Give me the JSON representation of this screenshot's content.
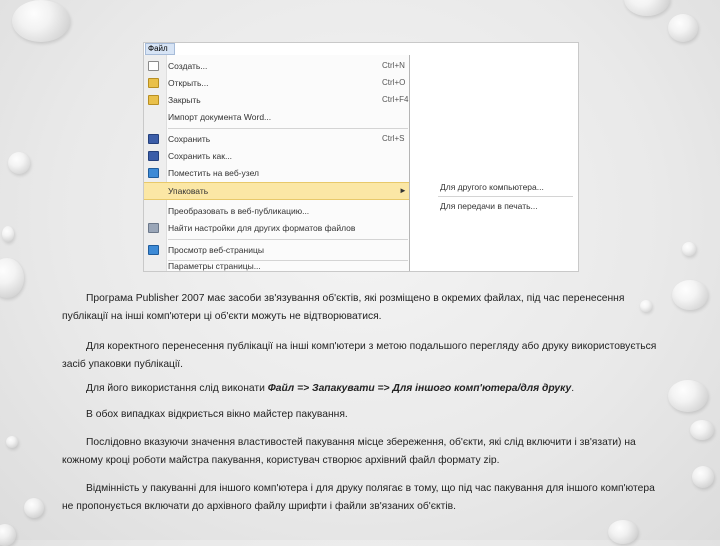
{
  "menubar": {
    "file_label": "Файл"
  },
  "menu": {
    "items": [
      {
        "label": "Создать...",
        "shortcut": "Ctrl+N",
        "icon": "new-doc-icon"
      },
      {
        "label": "Открыть...",
        "shortcut": "Ctrl+O",
        "icon": "open-folder-icon"
      },
      {
        "label": "Закрыть",
        "shortcut": "Ctrl+F4",
        "icon": "close-folder-icon"
      },
      {
        "label": "Импорт документа Word...",
        "shortcut": "",
        "icon": ""
      },
      {
        "label": "Сохранить",
        "shortcut": "Ctrl+S",
        "icon": "save-icon"
      },
      {
        "label": "Сохранить как...",
        "shortcut": "",
        "icon": "save-as-icon"
      },
      {
        "label": "Поместить на веб-узел",
        "shortcut": "",
        "icon": "web-publish-icon"
      },
      {
        "label": "Упаковать",
        "shortcut": "",
        "icon": "",
        "submenu_arrow": "►"
      },
      {
        "label": "Преобразовать в веб-публикацию...",
        "shortcut": "",
        "icon": ""
      },
      {
        "label": "Найти настройки для других форматов файлов",
        "shortcut": "",
        "icon": "find-settings-icon"
      },
      {
        "label": "Просмотр веб-страницы",
        "shortcut": "",
        "icon": "web-preview-icon"
      },
      {
        "label": "Параметры страницы...",
        "shortcut": "",
        "icon": ""
      }
    ],
    "submenu": [
      {
        "label": "Для другого компьютера..."
      },
      {
        "label": "Для передачи в печать..."
      }
    ]
  },
  "paragraphs": [
    {
      "text": "Програма Publisher 2007 має засоби зв'язування об'єктів, які розміщено в окремих файлах, під час перенесення публікації на інші комп'ютери ці об'єкти можуть не відтворюватися."
    },
    {
      "text": "Для коректного перенесення публікації на інші комп'ютери з метою подальшого перегляду або друку використовується засіб упаковки публікації."
    },
    {
      "text_before": "Для його використання слід виконати ",
      "text_bold": "Файл => Запакувати => Для іншого комп'ютера/для друку",
      "text_after": "."
    },
    {
      "text": "В обох випадках відкриється вікно майстер пакування."
    },
    {
      "text": "Послідовно вказуючи значення властивостей пакування місце збереження, об'єкти, які слід включити і зв'язати) на кожному кроці роботи майстра пакування, користувач створює архівний файл формату zip."
    },
    {
      "text": "Відмінність у пакуванні для іншого комп'ютера і для друку полягає в тому, що під час пакування для іншого комп'ютера не пропонується включати до архівного файлу шрифти і файли зв'язаних об'єктів."
    }
  ]
}
